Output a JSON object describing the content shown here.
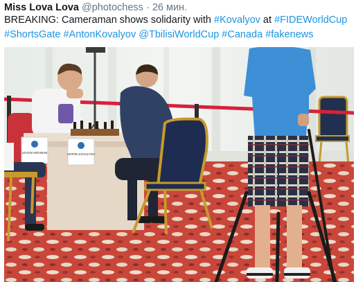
{
  "tweet": {
    "author_name": "Miss Lova Lova",
    "author_handle": "@photochess",
    "separator": "·",
    "timestamp": "26 мин.",
    "text_parts": [
      {
        "type": "text",
        "value": "BREAKING: Cameraman shows solidarity with "
      },
      {
        "type": "link",
        "value": "#Kovalyov"
      },
      {
        "type": "text",
        "value": " at "
      },
      {
        "type": "link",
        "value": "#FIDEWorldCup"
      },
      {
        "type": "text",
        "value": " "
      },
      {
        "type": "link",
        "value": "#ShortsGate"
      },
      {
        "type": "text",
        "value": " "
      },
      {
        "type": "link",
        "value": "#AntonKovalyov"
      },
      {
        "type": "text",
        "value": " "
      },
      {
        "type": "link",
        "value": "@TbilisiWorldCup"
      },
      {
        "type": "text",
        "value": " "
      },
      {
        "type": "link",
        "value": "#Canada"
      },
      {
        "type": "text",
        "value": " "
      },
      {
        "type": "link",
        "value": "#fakenews"
      }
    ],
    "link_color": "#1b95e0"
  },
  "media": {
    "nameplate_left": "LEVON ARONIAN",
    "nameplate_right": "ANTON KOVALYOV"
  }
}
